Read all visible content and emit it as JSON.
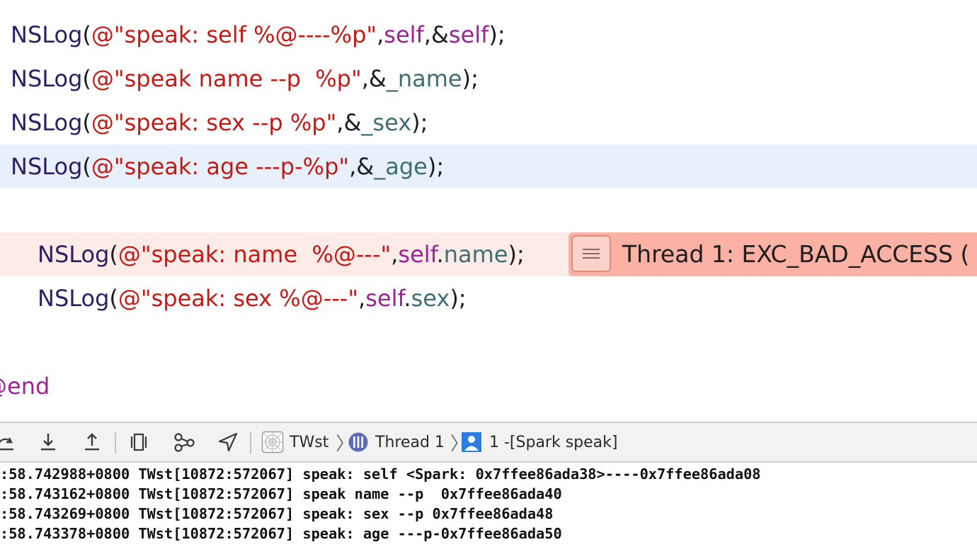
{
  "editor": {
    "lines": [
      [
        {
          "t": "NSLog",
          "c": "fn"
        },
        {
          "t": "(",
          "c": "pl"
        },
        {
          "t": "@\"speak: self %@----%p\"",
          "c": "str"
        },
        {
          "t": ",",
          "c": "pl"
        },
        {
          "t": "self",
          "c": "kw"
        },
        {
          "t": ",&",
          "c": "pl"
        },
        {
          "t": "self",
          "c": "kw"
        },
        {
          "t": ");",
          "c": "pl"
        }
      ],
      [
        {
          "t": "NSLog",
          "c": "fn"
        },
        {
          "t": "(",
          "c": "pl"
        },
        {
          "t": "@\"speak name --p  %p\"",
          "c": "str"
        },
        {
          "t": ",&",
          "c": "pl"
        },
        {
          "t": "_name",
          "c": "prop"
        },
        {
          "t": ");",
          "c": "pl"
        }
      ],
      [
        {
          "t": "NSLog",
          "c": "fn"
        },
        {
          "t": "(",
          "c": "pl"
        },
        {
          "t": "@\"speak: sex --p %p\"",
          "c": "str"
        },
        {
          "t": ",&",
          "c": "pl"
        },
        {
          "t": "_sex",
          "c": "prop"
        },
        {
          "t": ");",
          "c": "pl"
        }
      ],
      [
        {
          "t": "NSLog",
          "c": "fn"
        },
        {
          "t": "(",
          "c": "pl"
        },
        {
          "t": "@\"speak: age ---p-%p\"",
          "c": "str"
        },
        {
          "t": ",&",
          "c": "pl"
        },
        {
          "t": "_age",
          "c": "prop"
        },
        {
          "t": ");",
          "c": "pl"
        }
      ],
      [
        {
          "t": "NSLog",
          "c": "fn"
        },
        {
          "t": "(",
          "c": "pl"
        },
        {
          "t": "@\"speak: name  %@---\"",
          "c": "str"
        },
        {
          "t": ",",
          "c": "pl"
        },
        {
          "t": "self",
          "c": "kw"
        },
        {
          "t": ".",
          "c": "pl"
        },
        {
          "t": "name",
          "c": "prop"
        },
        {
          "t": ");",
          "c": "pl"
        }
      ],
      [
        {
          "t": "NSLog",
          "c": "fn"
        },
        {
          "t": "(",
          "c": "pl"
        },
        {
          "t": "@\"speak: sex %@---\"",
          "c": "str"
        },
        {
          "t": ",",
          "c": "pl"
        },
        {
          "t": "self",
          "c": "kw"
        },
        {
          "t": ".",
          "c": "pl"
        },
        {
          "t": "sex",
          "c": "prop"
        },
        {
          "t": ");",
          "c": "pl"
        }
      ],
      [
        {
          "t": "@end",
          "c": "kw"
        }
      ]
    ],
    "error_banner": {
      "message": "Thread 1: EXC_BAD_ACCESS (",
      "icon": "lines-icon"
    },
    "colors": {
      "function": "#2d1f66",
      "string": "#c41a16",
      "keyword": "#9b2393",
      "property": "#3e6d74",
      "current_line": "#e7f0fb",
      "error_line": "#fdebe8",
      "error_banner": "#fbb1a4"
    }
  },
  "debug_bar": {
    "buttons": [
      {
        "name": "step-into-icon"
      },
      {
        "name": "step-into-icon"
      },
      {
        "name": "step-out-icon"
      },
      {
        "name": "view-hierarchy-icon"
      },
      {
        "name": "memory-graph-icon"
      },
      {
        "name": "simulate-location-icon"
      }
    ],
    "breadcrumbs": {
      "target": "TWst",
      "thread": "Thread 1",
      "frame": "1 -[Spark speak]"
    }
  },
  "console": {
    "lines": [
      ":58.742988+0800 TWst[10872:572067] speak: self <Spark: 0x7ffee86ada38>----0x7ffee86ada08",
      ":58.743162+0800 TWst[10872:572067] speak name --p  0x7ffee86ada40",
      ":58.743269+0800 TWst[10872:572067] speak: sex --p 0x7ffee86ada48",
      ":58.743378+0800 TWst[10872:572067] speak: age ---p-0x7ffee86ada50"
    ]
  }
}
